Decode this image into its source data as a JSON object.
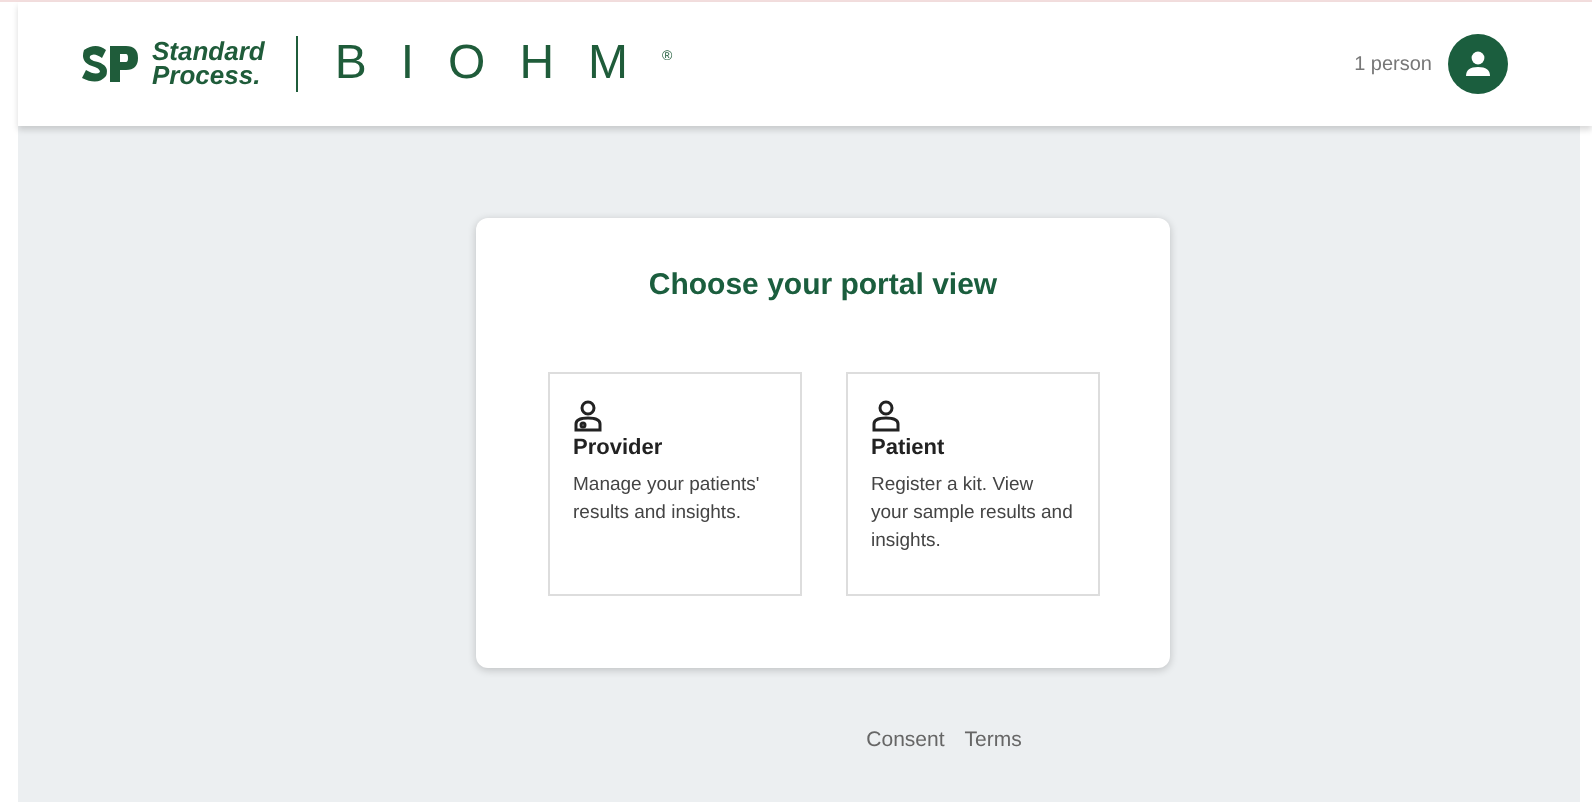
{
  "header": {
    "brand_top": "Standard",
    "brand_bottom": "Process.",
    "product": "BIOHM",
    "product_mark": "®",
    "user_label": "1 person"
  },
  "portal": {
    "title": "Choose your portal view",
    "options": [
      {
        "kind": "provider",
        "title": "Provider",
        "description": "Manage your patients' results and insights."
      },
      {
        "kind": "patient",
        "title": "Patient",
        "description": "Register a kit. View your sample results and insights."
      }
    ]
  },
  "footer": {
    "links": [
      "Consent",
      "Terms"
    ]
  }
}
